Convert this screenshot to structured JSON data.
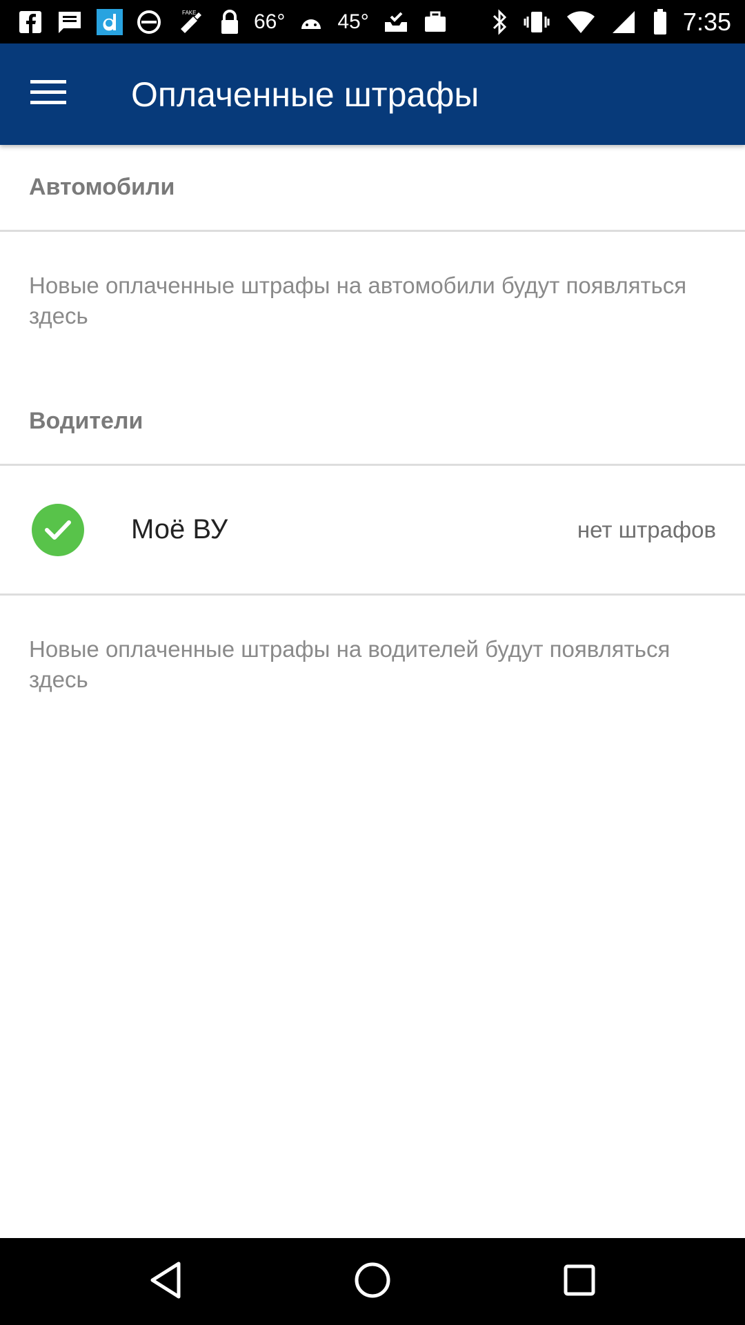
{
  "status_bar": {
    "temp1": "66°",
    "temp2": "45°",
    "time": "7:35",
    "icons": [
      "facebook-icon",
      "message-icon",
      "d-app-icon",
      "block-icon",
      "satellite-fake-icon",
      "lock-icon",
      "weather-icon",
      "android-icon",
      "weather-icon",
      "check-inbox-icon",
      "briefcase-icon",
      "bluetooth-icon",
      "vibrate-icon",
      "wifi-icon",
      "signal-icon",
      "battery-icon"
    ]
  },
  "app_bar": {
    "title": "Оплаченные штрафы",
    "menu_icon": "hamburger-menu-icon",
    "color": "#073a7a"
  },
  "sections": {
    "cars": {
      "header": "Автомобили",
      "empty_text": "Новые оплаченные штрафы на автомобили будут появляться здесь"
    },
    "drivers": {
      "header": "Водители",
      "items": [
        {
          "name": "Моё ВУ",
          "status": "нет штрафов",
          "icon": "check-circle-icon"
        }
      ],
      "empty_text": "Новые оплаченные штрафы на водителей будут появляться здесь"
    }
  },
  "colors": {
    "check_green": "#58c34a"
  },
  "nav_bar": {
    "buttons": [
      "back-icon",
      "home-icon",
      "recents-icon"
    ]
  }
}
